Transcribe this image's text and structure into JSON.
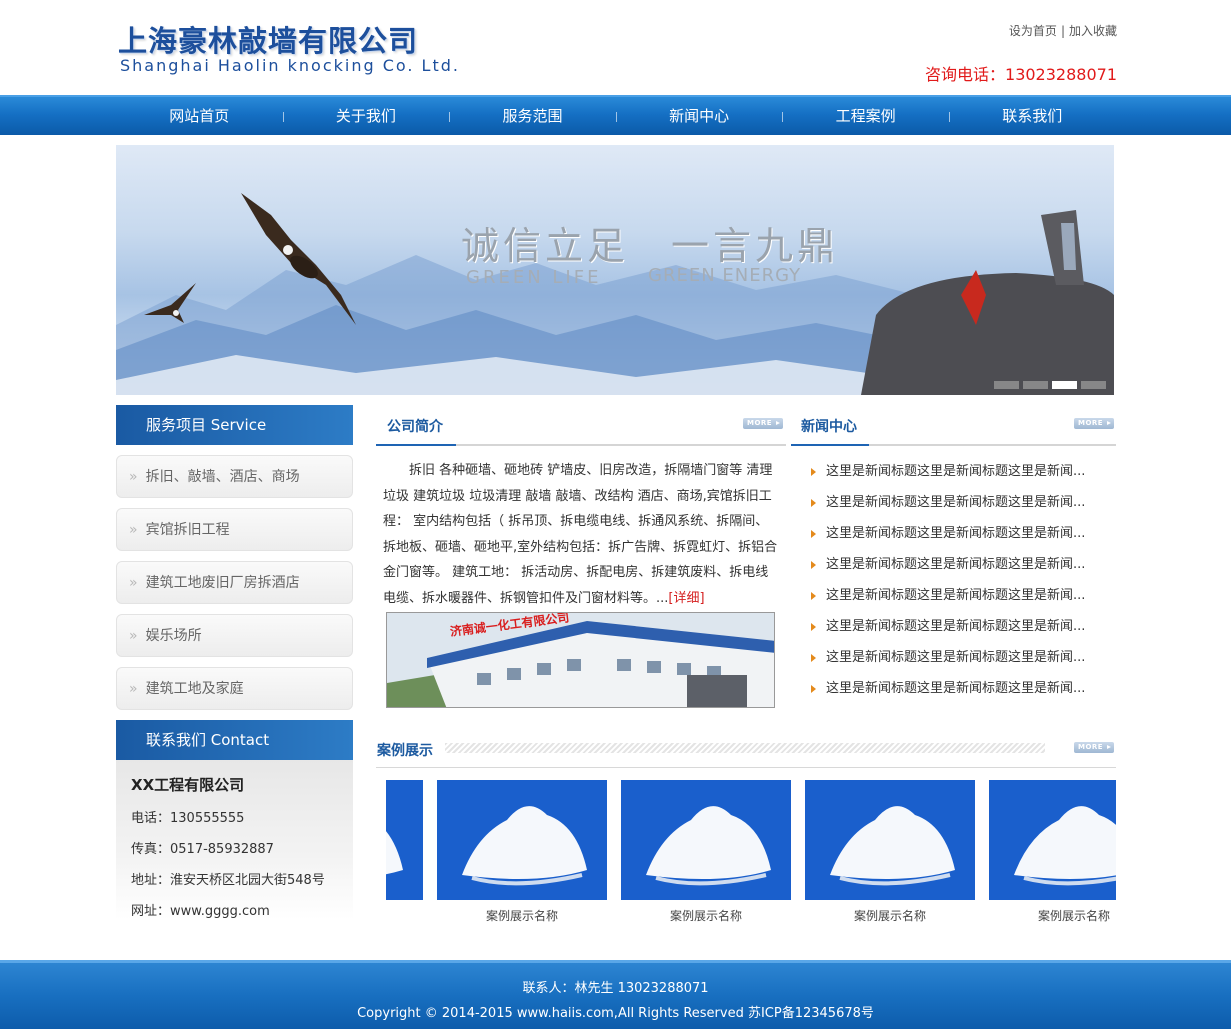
{
  "header": {
    "logo_cn": "上海豪林敲墙有限公司",
    "logo_en": "Shanghai Haolin knocking Co. Ltd.",
    "set_home": "设为首页",
    "separator": "|",
    "add_favorite": "加入收藏",
    "hotline": "咨询电话：13023288071"
  },
  "nav": {
    "items": [
      "网站首页",
      "关于我们",
      "服务范围",
      "新闻中心",
      "工程案例",
      "联系我们"
    ]
  },
  "banner": {
    "slogan_cn": "诚信立足　一言九鼎",
    "slogan_en1": "GREEN LIFE",
    "slogan_en2": "GREEN ENERGY",
    "slides_total": 4,
    "active_slide": 3
  },
  "sidebar": {
    "service_title": "服务项目 Service",
    "service_items": [
      "拆旧、敲墙、酒店、商场",
      "宾馆拆旧工程",
      "建筑工地废旧厂房拆酒店",
      "娱乐场所",
      "建筑工地及家庭"
    ],
    "arrow_glyph": "»",
    "contact_title": "联系我们 Contact",
    "contact_company": "XX工程有限公司",
    "contact_phone": "电话：130555555",
    "contact_fax": "传真：0517-85932887",
    "contact_address": "地址：淮安天桥区北园大街548号",
    "contact_web": "网址：www.gggg.com"
  },
  "about": {
    "title": "公司简介",
    "more_label": "MORE",
    "text": "　　拆旧 各种砸墙、砸地砖 铲墙皮、旧房改造，拆隔墙门窗等 清理垃圾 建筑垃圾 垃圾清理 敲墙 敲墙、改结构 酒店、商场,宾馆拆旧工程： 室内结构包括（ 拆吊顶、拆电缆电线、拆通风系统、拆隔间、拆地板、砸墙、砸地平,室外结构包括：拆广告牌、拆霓虹灯、拆铝合金门窗等。 建筑工地： 拆活动房、拆配电房、拆建筑废料、拆电线电缆、拆水暖器件、拆钢管扣件及门窗材料等。...",
    "detail_link": "[详细]",
    "image_sign": "济南诚一化工有限公司"
  },
  "news": {
    "title": "新闻中心",
    "more_label": "MORE",
    "items": [
      "这里是新闻标题这里是新闻标题这里是新闻...",
      "这里是新闻标题这里是新闻标题这里是新闻...",
      "这里是新闻标题这里是新闻标题这里是新闻...",
      "这里是新闻标题这里是新闻标题这里是新闻...",
      "这里是新闻标题这里是新闻标题这里是新闻...",
      "这里是新闻标题这里是新闻标题这里是新闻...",
      "这里是新闻标题这里是新闻标题这里是新闻...",
      "这里是新闻标题这里是新闻标题这里是新闻..."
    ]
  },
  "cases": {
    "title": "案例展示",
    "more_label": "MORE",
    "items": [
      "案例展示名称",
      "案例展示名称",
      "案例展示名称",
      "案例展示名称"
    ]
  },
  "footer": {
    "contact": "联系人：林先生 13023288071",
    "copyright": "Copyright © 2014-2015 www.haiis.com,All Rights Reserved 苏ICP备12345678号"
  },
  "colors": {
    "brand_blue": "#1d4f9c",
    "nav_blue": "#1570c4",
    "hotline_red": "#e11a1a",
    "bullet_orange": "#e48a1c"
  }
}
